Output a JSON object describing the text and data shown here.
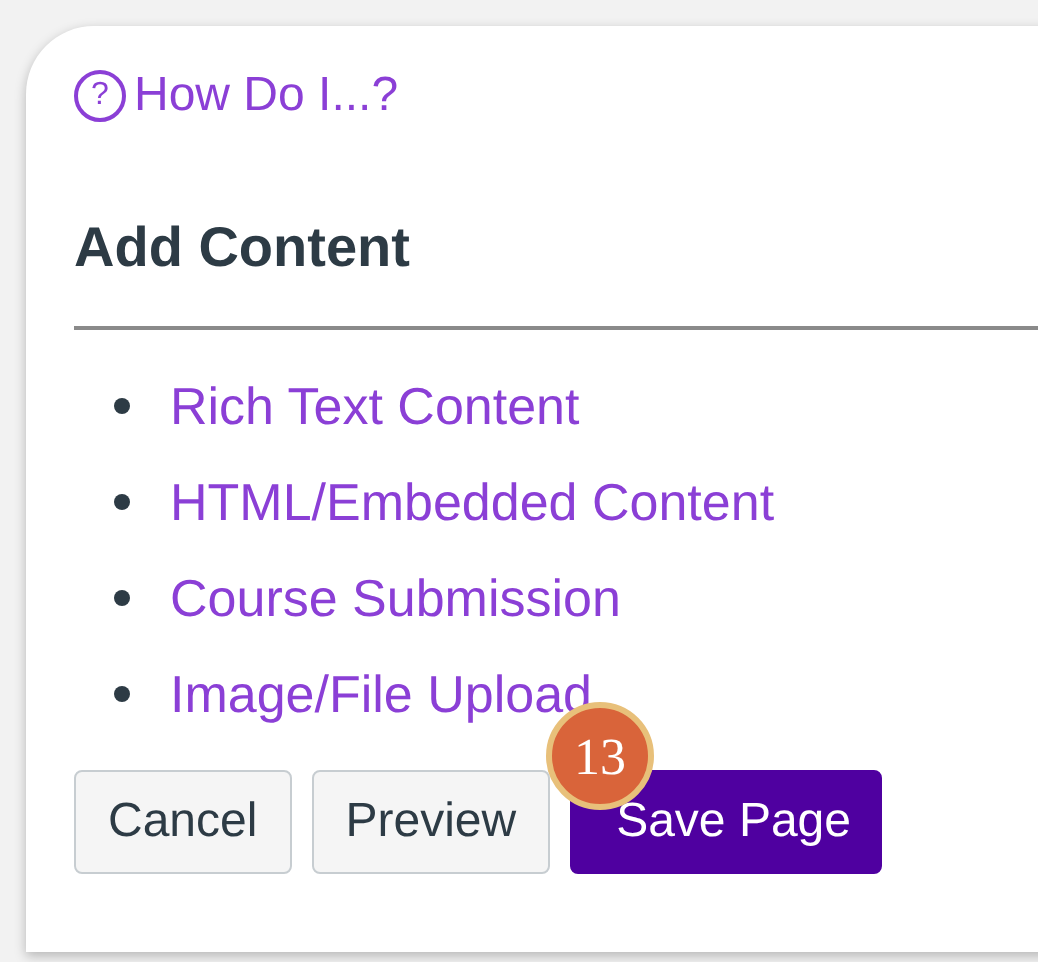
{
  "help_link": {
    "icon": "?",
    "label": "How Do I...?"
  },
  "heading": "Add Content",
  "content_types": [
    {
      "label": "Rich Text Content"
    },
    {
      "label": "HTML/Embedded Content"
    },
    {
      "label": "Course Submission"
    },
    {
      "label": "Image/File Upload"
    }
  ],
  "buttons": [
    {
      "label": "Cancel",
      "kind": "secondary"
    },
    {
      "label": "Preview",
      "kind": "secondary"
    },
    {
      "label": "Save Page",
      "kind": "primary"
    }
  ],
  "step_badge": "13"
}
